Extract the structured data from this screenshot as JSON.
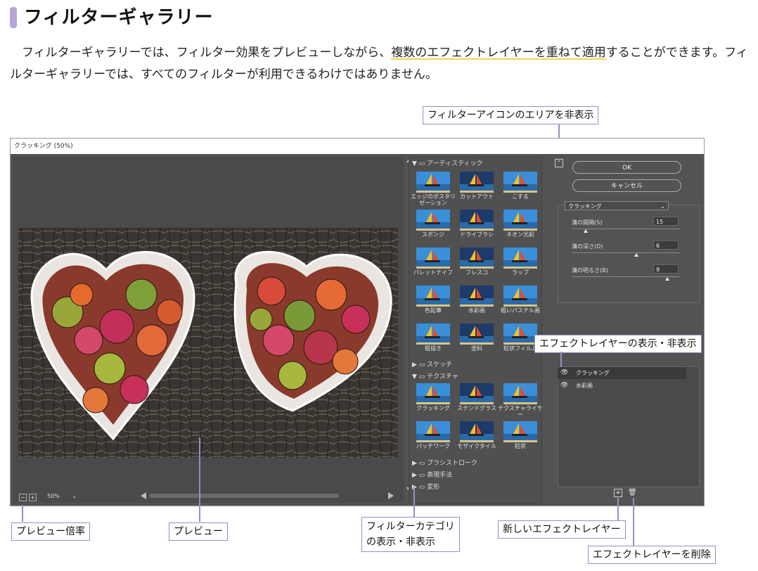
{
  "heading": "フィルターギャラリー",
  "paragraph": {
    "part1": "フィルターギャラリーでは、フィルター効果をプレビューしながら、",
    "highlight": "複数のエフェクトレイヤーを重ねて適用",
    "part2": "することができます。フィルターギャラリーでは、すべてのフィルターが利用できるわけではありません。"
  },
  "callouts": {
    "hide_icon_area": "フィルターアイコンのエリアを非表示",
    "effect_layer_visibility": "エフェクトレイヤーの表示・非表示",
    "preview_zoom": "プレビュー倍率",
    "preview": "プレビュー",
    "category_toggle_line1": "フィルターカテゴリ",
    "category_toggle_line2": "の表示・非表示",
    "new_effect_layer": "新しいエフェクトレイヤー",
    "delete_effect_layer": "エフェクトレイヤーを削除"
  },
  "dialog": {
    "title": "クラッキング (50%)",
    "zoom_value": "50%",
    "zoom_minus": "−",
    "zoom_plus": "+",
    "categories": {
      "artistic": "アーティスティック",
      "sketch": "スケッチ",
      "texture": "テクスチャ",
      "brush": "ブラシストローク",
      "stylize": "表現手法",
      "distort": "変形"
    },
    "artistic_filters": [
      "エッジのポスタリゼーション",
      "カットアウト",
      "こする",
      "スポンジ",
      "ドライブラシ",
      "ネオン光彩",
      "パレットナイフ",
      "フレスコ",
      "ラップ",
      "色鉛筆",
      "水彩画",
      "粗いパステル画",
      "粗描き",
      "塗料",
      "粒状フィルム"
    ],
    "texture_filters": [
      "クラッキング",
      "ステンドグラス",
      "テクスチャライザー",
      "パッチワーク",
      "モザイクタイル",
      "粒状"
    ],
    "ok_label": "OK",
    "cancel_label": "キャンセル",
    "filter_select": "クラッキング",
    "params": [
      {
        "label": "溝の間隔(S)",
        "value": "15",
        "level": 0.13
      },
      {
        "label": "溝の深さ(D)",
        "value": "6",
        "level": 0.6
      },
      {
        "label": "溝の明るさ(B)",
        "value": "9",
        "level": 0.88
      }
    ],
    "layers": [
      "クラッキング",
      "水彩画"
    ]
  },
  "colors": {
    "accent": "#9a8cc4",
    "highlight_underline": "#f2d64a",
    "dialog_bg": "#535353"
  }
}
